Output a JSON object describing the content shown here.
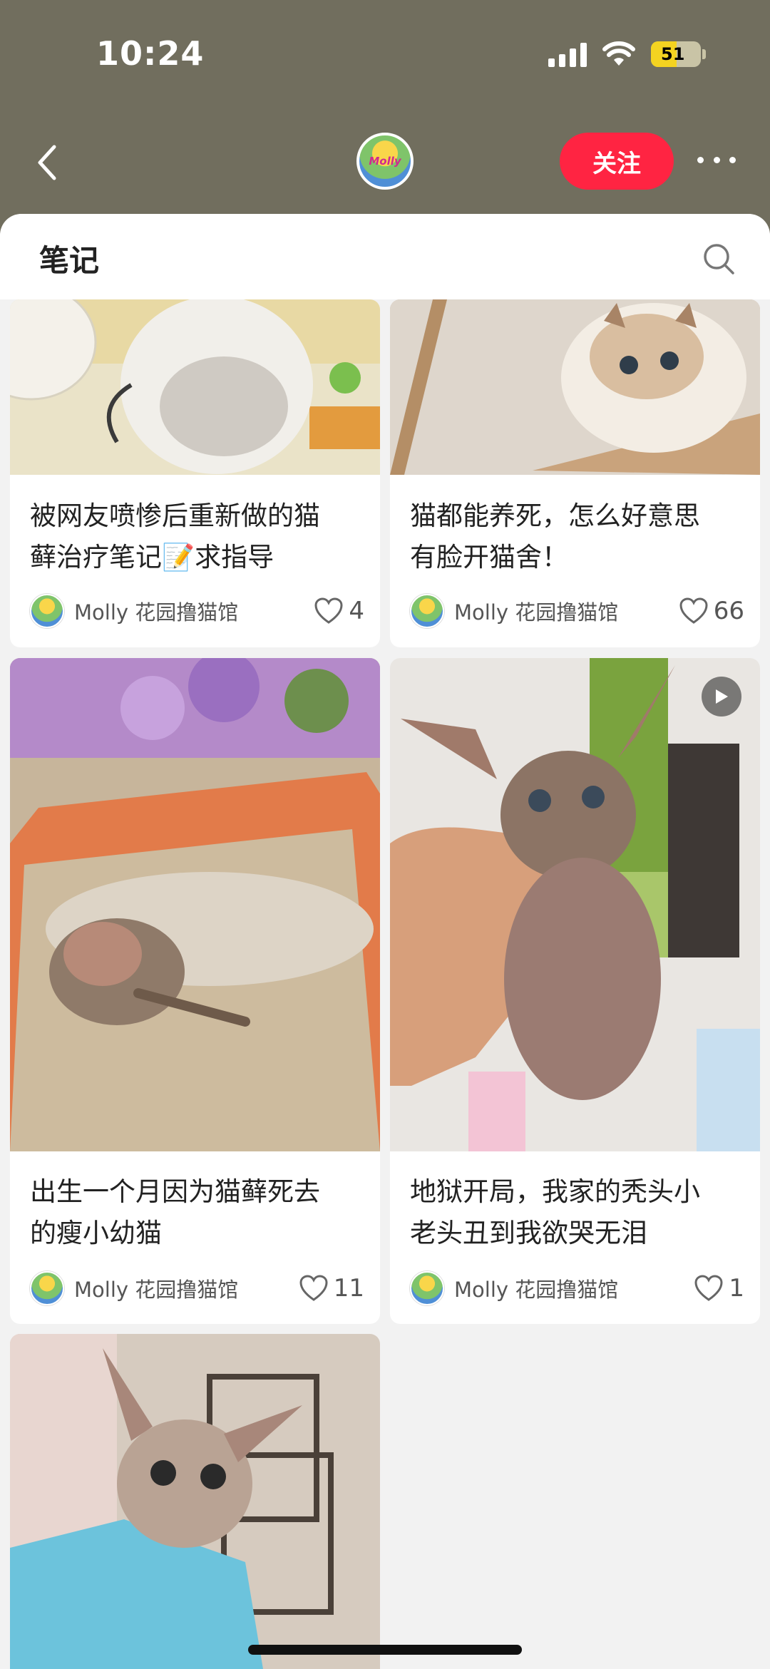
{
  "status": {
    "time": "10:24",
    "battery": "51"
  },
  "header": {
    "avatar_text": "Molly",
    "follow_label": "关注"
  },
  "section": {
    "title": "笔记"
  },
  "colors": {
    "accent": "#ff2442",
    "header_bg": "#716e5e"
  },
  "notes": [
    {
      "title_l1": "被网友喷惨后重新做的猫",
      "title_l2": "藓治疗笔记📝求指导",
      "author": "Molly 花园撸猫馆",
      "likes": "4"
    },
    {
      "title_l1": "猫都能养死，怎么好意思",
      "title_l2": "有脸开猫舍！",
      "author": "Molly 花园撸猫馆",
      "likes": "66"
    },
    {
      "title_l1": "出生一个月因为猫藓死去",
      "title_l2": "的瘦小幼猫",
      "author": "Molly 花园撸猫馆",
      "likes": "11"
    },
    {
      "title_l1": "地狱开局，我家的秃头小",
      "title_l2": "老头丑到我欲哭无泪",
      "author": "Molly 花园撸猫馆",
      "likes": "1"
    }
  ]
}
